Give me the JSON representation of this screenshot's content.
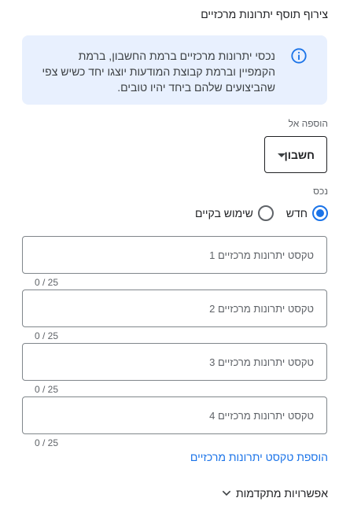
{
  "section": {
    "title": "צירוף תוסף יתרונות מרכזיים"
  },
  "info": {
    "icon": "info-icon",
    "text": "נכסי יתרונות מרכזיים ברמת החשבון, ברמת הקמפיין וברמת קבוצת המודעות יוצגו יחד כשיש צפי שהביצועים שלהם ביחד יהיו טובים."
  },
  "add_to": {
    "label": "הוספה אל",
    "selected": "חשבון"
  },
  "asset": {
    "label": "נכס",
    "options": [
      {
        "label": "חדש",
        "checked": true
      },
      {
        "label": "שימוש בקיים",
        "checked": false
      }
    ]
  },
  "fields": [
    {
      "placeholder": "טקסט יתרונות מרכזיים 1",
      "counter": "0 / 25"
    },
    {
      "placeholder": "טקסט יתרונות מרכזיים 2",
      "counter": "0 / 25"
    },
    {
      "placeholder": "טקסט יתרונות מרכזיים 3",
      "counter": "0 / 25"
    },
    {
      "placeholder": "טקסט יתרונות מרכזיים 4",
      "counter": "0 / 25"
    }
  ],
  "add_link": "הוספת טקסט יתרונות מרכזיים",
  "advanced": {
    "label": "אפשרויות מתקדמות",
    "icon": "chevron-down-icon"
  },
  "colors": {
    "accent": "#1a73e8",
    "info_bg": "#e8f0fe"
  }
}
